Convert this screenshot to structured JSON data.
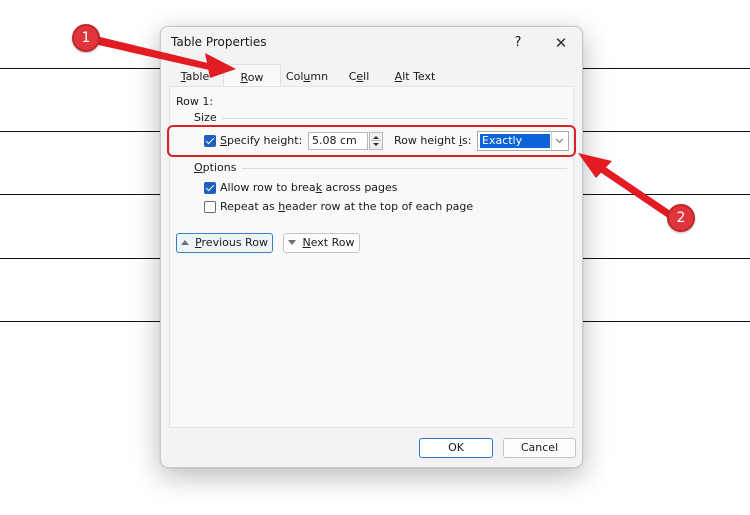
{
  "dialog": {
    "title": "Table Properties",
    "help_label": "?",
    "close_label": "✕",
    "tabs": [
      {
        "label_pre": "",
        "label_u": "T",
        "label_post": "able",
        "active": false
      },
      {
        "label_pre": "",
        "label_u": "R",
        "label_post": "ow",
        "active": true
      },
      {
        "label_pre": "Col",
        "label_u": "u",
        "label_post": "mn",
        "active": false
      },
      {
        "label_pre": "C",
        "label_u": "e",
        "label_post": "ll",
        "active": false
      },
      {
        "label_pre": "",
        "label_u": "A",
        "label_post": "lt Text",
        "active": false
      }
    ],
    "row_heading": "Row 1:",
    "size_section": {
      "label": "Size",
      "specify_height": {
        "label_u": "S",
        "label_post": "pecify height:",
        "checked": true
      },
      "height_value": "5.08 cm",
      "row_height_is": {
        "label_pre": "Row height ",
        "label_u": "i",
        "label_post": "s:"
      },
      "row_height_mode": "Exactly"
    },
    "options_section": {
      "label_u": "O",
      "label_post": "ptions",
      "allow_break": {
        "label_pre": "Allow row to brea",
        "label_u": "k",
        "label_post": " across pages",
        "checked": true
      },
      "repeat_header": {
        "label_pre": "Repeat as ",
        "label_u": "h",
        "label_post": "eader row at the top of each page",
        "checked": false
      }
    },
    "prev_row": {
      "label_u": "P",
      "label_post": "revious Row"
    },
    "next_row": {
      "label_u": "N",
      "label_post": "ext Row"
    },
    "ok_label": "OK",
    "cancel_label": "Cancel"
  },
  "annotations": {
    "badge_1": "1",
    "badge_2": "2",
    "accent_color": "#e0353c"
  }
}
